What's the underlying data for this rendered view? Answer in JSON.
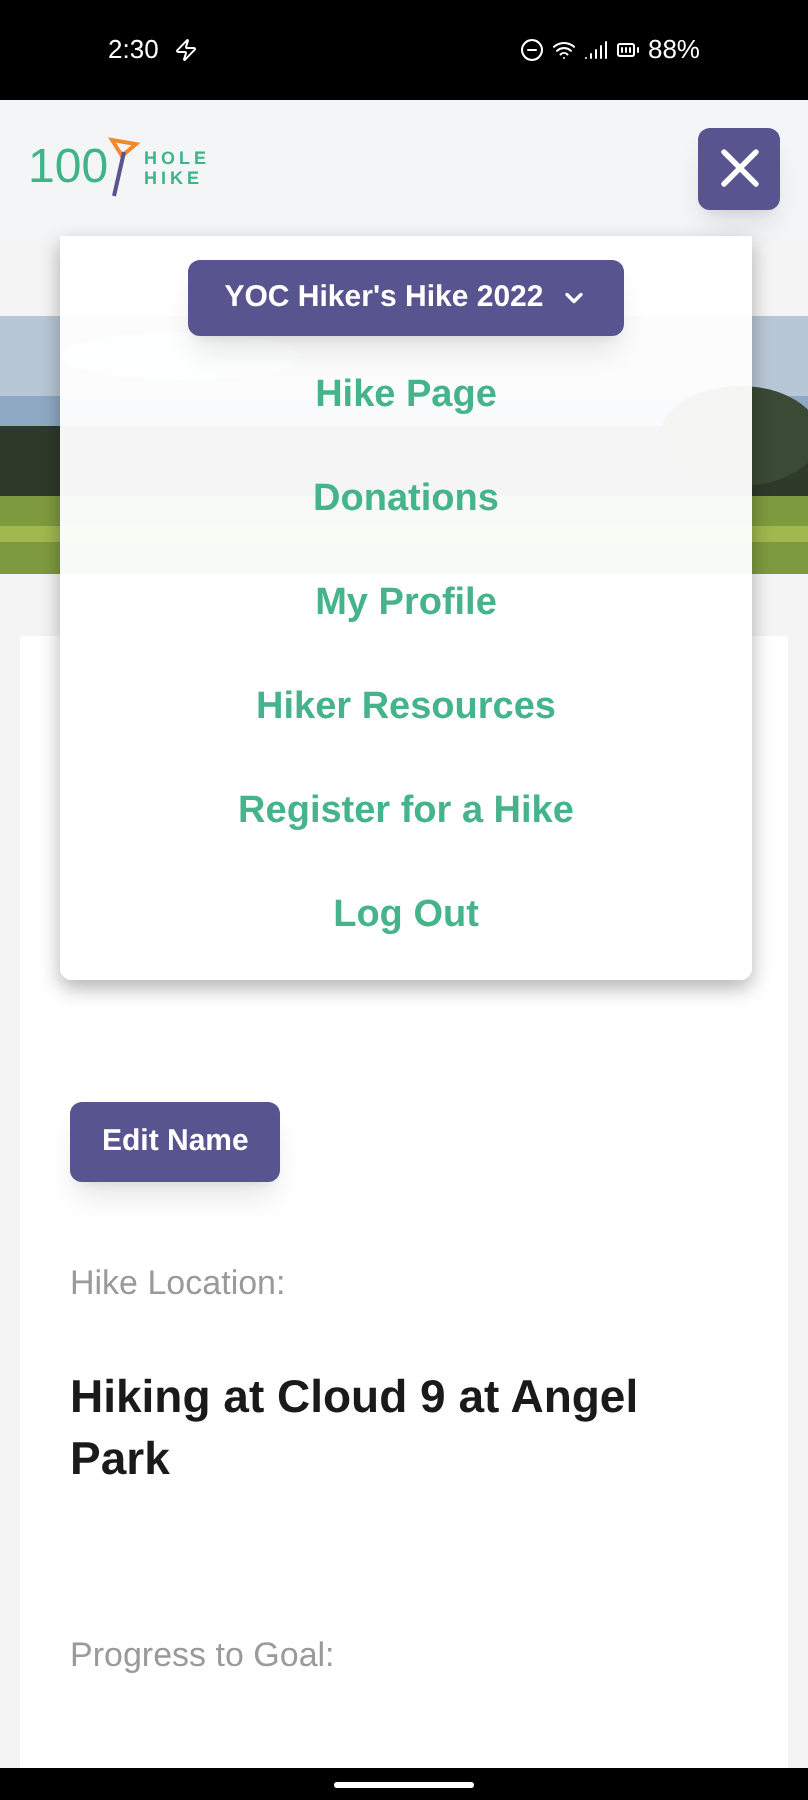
{
  "status_bar": {
    "time": "2:30",
    "battery": "88%"
  },
  "header": {
    "logo_number": "100",
    "logo_word_1": "HOLE",
    "logo_word_2": "HIKE"
  },
  "menu": {
    "selector": "YOC Hiker's Hike 2022",
    "items": [
      {
        "label": "Hike Page"
      },
      {
        "label": "Donations"
      },
      {
        "label": "My Profile"
      },
      {
        "label": "Hiker Resources"
      },
      {
        "label": "Register for a Hike"
      },
      {
        "label": "Log Out"
      }
    ]
  },
  "card": {
    "edit_button": "Edit Name",
    "location_label": "Hike Location:",
    "location": "Hiking at Cloud 9 at Angel Park",
    "progress_label": "Progress to Goal:"
  }
}
